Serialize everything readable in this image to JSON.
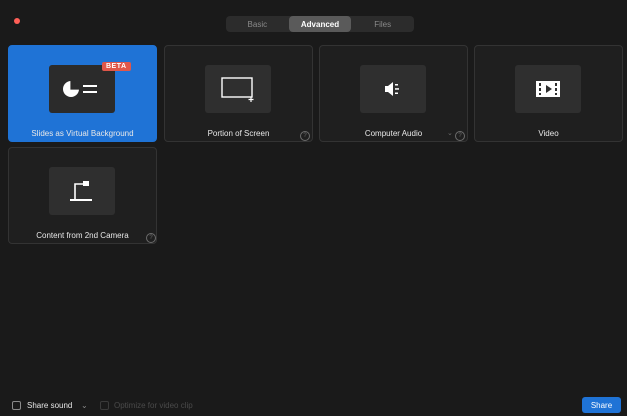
{
  "tabs": [
    {
      "label": "Basic",
      "active": false
    },
    {
      "label": "Advanced",
      "active": true
    },
    {
      "label": "Files",
      "active": false
    }
  ],
  "cards": [
    {
      "label": "Slides as Virtual Background",
      "badge": "BETA",
      "icon": "slides-icon",
      "selected": true
    },
    {
      "label": "Portion of Screen",
      "icon": "portion-screen-icon",
      "help": "?"
    },
    {
      "label": "Computer Audio",
      "icon": "speaker-icon",
      "dropdown": "⌄",
      "help": "?"
    },
    {
      "label": "Video",
      "icon": "film-icon"
    },
    {
      "label": "Content from 2nd Camera",
      "icon": "document-camera-icon",
      "help": "?"
    }
  ],
  "footer": {
    "share_sound": "Share sound",
    "share_sound_dropdown": "⌄",
    "optimize": "Optimize for video clip",
    "share_button": "Share"
  },
  "colors": {
    "accent": "#1f73d6",
    "badge": "#e0574a",
    "close": "#ff5f57"
  }
}
